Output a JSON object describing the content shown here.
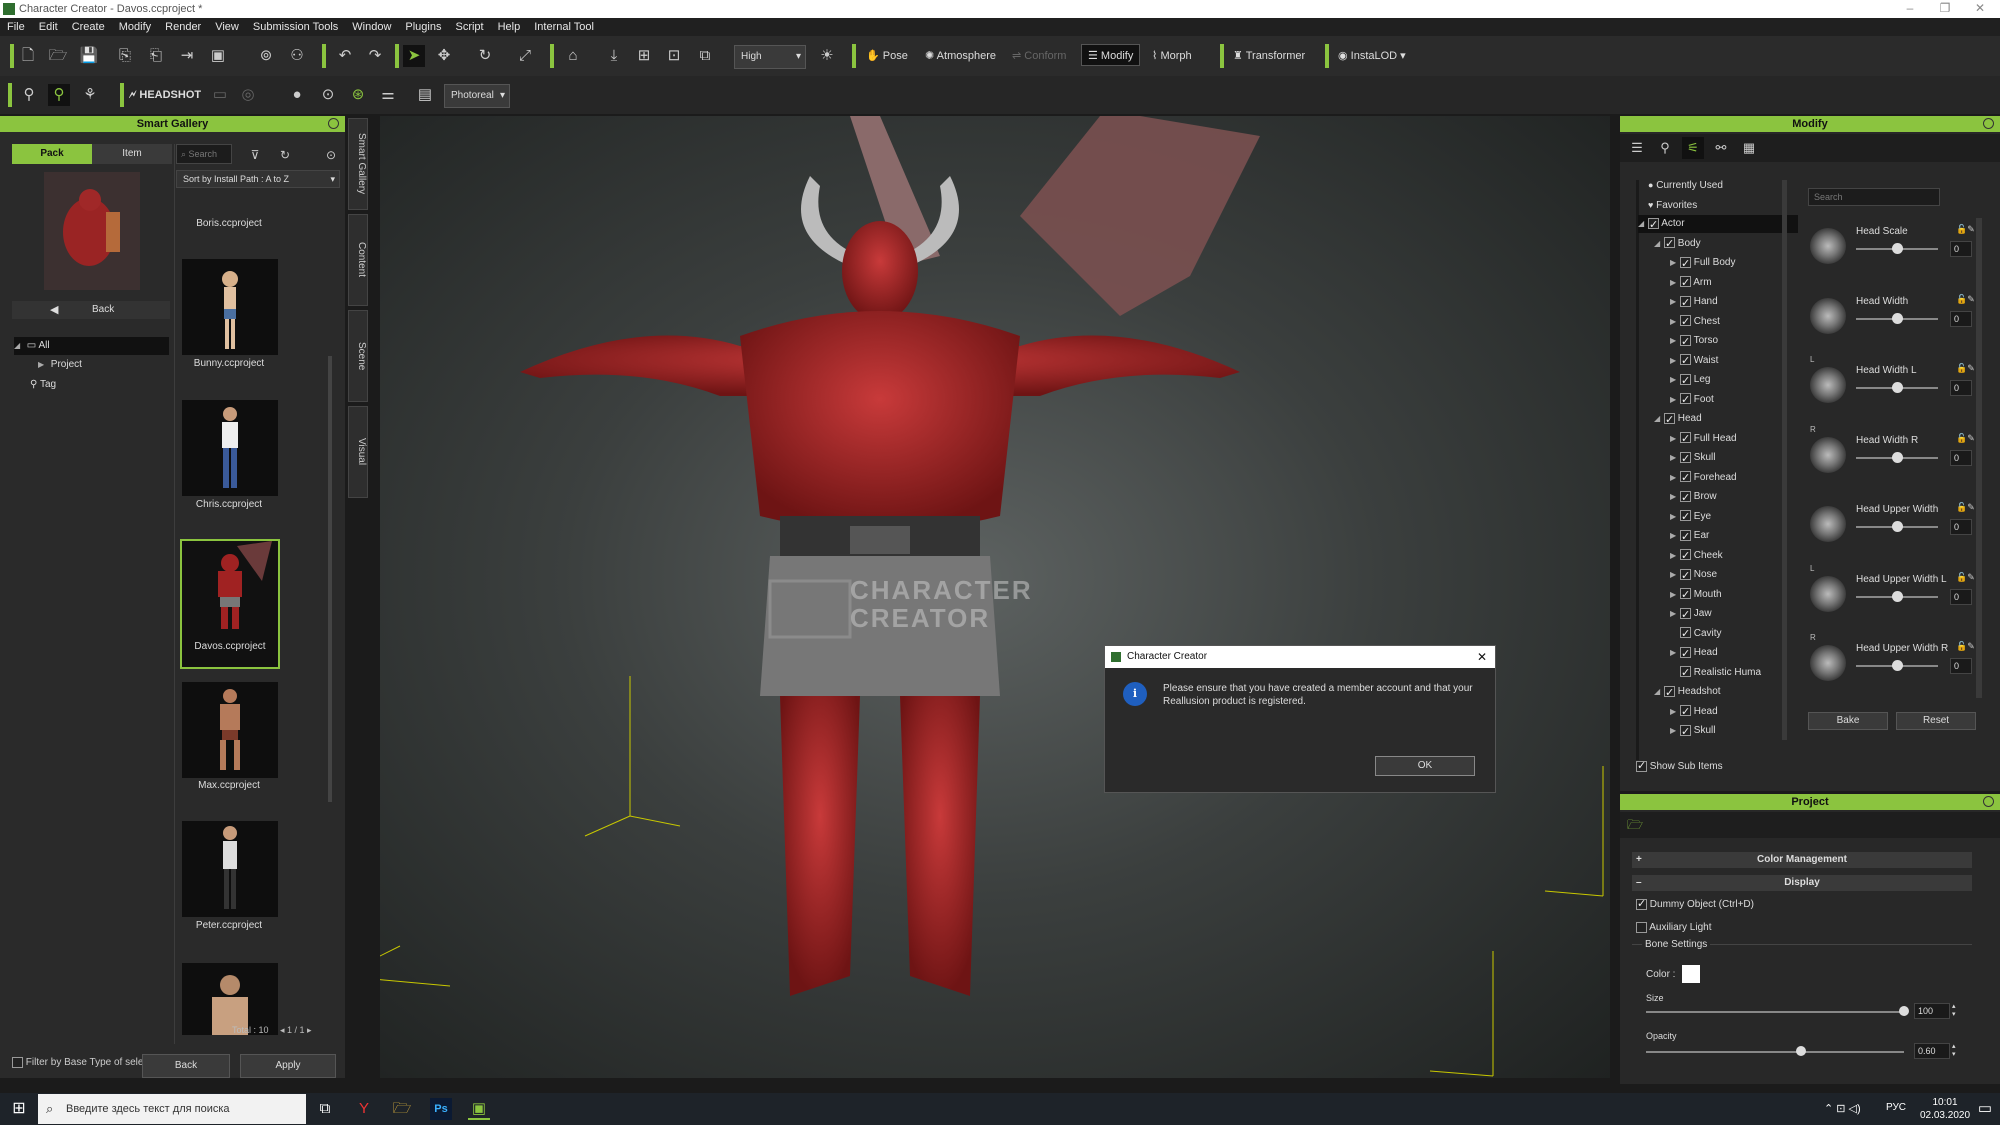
{
  "window": {
    "title": "Character Creator - Davos.ccproject *"
  },
  "menu": [
    "File",
    "Edit",
    "Create",
    "Modify",
    "Render",
    "View",
    "Submission Tools",
    "Window",
    "Plugins",
    "Script",
    "Help",
    "Internal Tool"
  ],
  "toolbar": {
    "quality": "High",
    "pose": "Pose",
    "atmosphere": "Atmosphere",
    "conform": "Conform",
    "modify": "Modify",
    "morph": "Morph",
    "transformer": "Transformer",
    "instalod": "InstaLOD",
    "headshot": "HEADSHOT",
    "render_mode": "Photoreal"
  },
  "smart_gallery": {
    "title": "Smart Gallery",
    "tabs": [
      "Pack",
      "Item"
    ],
    "search_placeholder": "Search",
    "sort": "Sort by Install Path : A to Z",
    "back": "Back",
    "tree": [
      "All",
      "Project",
      "Tag"
    ],
    "items": [
      "Boris.ccproject",
      "Bunny.ccproject",
      "Chris.ccproject",
      "Davos.ccproject",
      "Max.ccproject",
      "Peter.ccproject"
    ],
    "total": "Total : 10",
    "page": "1 / 1",
    "filter": "Filter by Base Type of sele",
    "back_btn": "Back",
    "apply_btn": "Apply",
    "vertical_tabs": [
      "Smart Gallery",
      "Content",
      "Scene",
      "Visual"
    ]
  },
  "viewport": {
    "watermark_line1": "CHARACTER",
    "watermark_line2": "CREATOR"
  },
  "dialog": {
    "title": "Character Creator",
    "message_line1": "Please ensure that you have created a member account and that your",
    "message_line2": "Reallusion product is registered.",
    "ok": "OK"
  },
  "modify": {
    "title": "Modify",
    "search_placeholder": "Search",
    "tree": [
      {
        "label": "Currently Used",
        "level": 0,
        "type": "dot"
      },
      {
        "label": "Favorites",
        "level": 0,
        "type": "heart"
      },
      {
        "label": "Actor",
        "level": 0,
        "type": "chk",
        "open": true
      },
      {
        "label": "Body",
        "level": 1,
        "type": "chk",
        "open": true
      },
      {
        "label": "Full Body",
        "level": 2,
        "type": "chk"
      },
      {
        "label": "Arm",
        "level": 2,
        "type": "chk"
      },
      {
        "label": "Hand",
        "level": 2,
        "type": "chk"
      },
      {
        "label": "Chest",
        "level": 2,
        "type": "chk"
      },
      {
        "label": "Torso",
        "level": 2,
        "type": "chk"
      },
      {
        "label": "Waist",
        "level": 2,
        "type": "chk"
      },
      {
        "label": "Leg",
        "level": 2,
        "type": "chk"
      },
      {
        "label": "Foot",
        "level": 2,
        "type": "chk"
      },
      {
        "label": "Head",
        "level": 1,
        "type": "chk",
        "open": true
      },
      {
        "label": "Full Head",
        "level": 2,
        "type": "chk"
      },
      {
        "label": "Skull",
        "level": 2,
        "type": "chk"
      },
      {
        "label": "Forehead",
        "level": 2,
        "type": "chk"
      },
      {
        "label": "Brow",
        "level": 2,
        "type": "chk"
      },
      {
        "label": "Eye",
        "level": 2,
        "type": "chk"
      },
      {
        "label": "Ear",
        "level": 2,
        "type": "chk"
      },
      {
        "label": "Cheek",
        "level": 2,
        "type": "chk"
      },
      {
        "label": "Nose",
        "level": 2,
        "type": "chk"
      },
      {
        "label": "Mouth",
        "level": 2,
        "type": "chk"
      },
      {
        "label": "Jaw",
        "level": 2,
        "type": "chk"
      },
      {
        "label": "Cavity",
        "level": 2,
        "type": "chk"
      },
      {
        "label": "Head",
        "level": 2,
        "type": "chk"
      },
      {
        "label": "Realistic Huma",
        "level": 2,
        "type": "chk"
      },
      {
        "label": "Headshot",
        "level": 1,
        "type": "chk",
        "open": true
      },
      {
        "label": "Head",
        "level": 2,
        "type": "chk"
      },
      {
        "label": "Skull",
        "level": 2,
        "type": "chk"
      }
    ],
    "sliders": [
      {
        "label": "Head Scale",
        "value": "0",
        "prefix": ""
      },
      {
        "label": "Head Width",
        "value": "0",
        "prefix": ""
      },
      {
        "label": "Head Width L",
        "value": "0",
        "prefix": "L"
      },
      {
        "label": "Head Width R",
        "value": "0",
        "prefix": "R"
      },
      {
        "label": "Head Upper Width",
        "value": "0",
        "prefix": ""
      },
      {
        "label": "Head Upper Width L",
        "value": "0",
        "prefix": "L"
      },
      {
        "label": "Head Upper Width R",
        "value": "0",
        "prefix": "R"
      }
    ],
    "bake": "Bake",
    "reset": "Reset",
    "show_sub": "Show Sub Items"
  },
  "project": {
    "title": "Project",
    "color_management": "Color Management",
    "display": "Display",
    "dummy": "Dummy Object (Ctrl+D)",
    "aux_light": "Auxiliary Light",
    "bone_settings": "Bone Settings",
    "color_label": "Color :",
    "size_label": "Size",
    "size_value": "100",
    "opacity_label": "Opacity",
    "opacity_value": "0.60"
  },
  "taskbar": {
    "search_placeholder": "Введите здесь текст для поиска",
    "lang": "РУС",
    "time": "10:01",
    "date": "02.03.2020"
  }
}
